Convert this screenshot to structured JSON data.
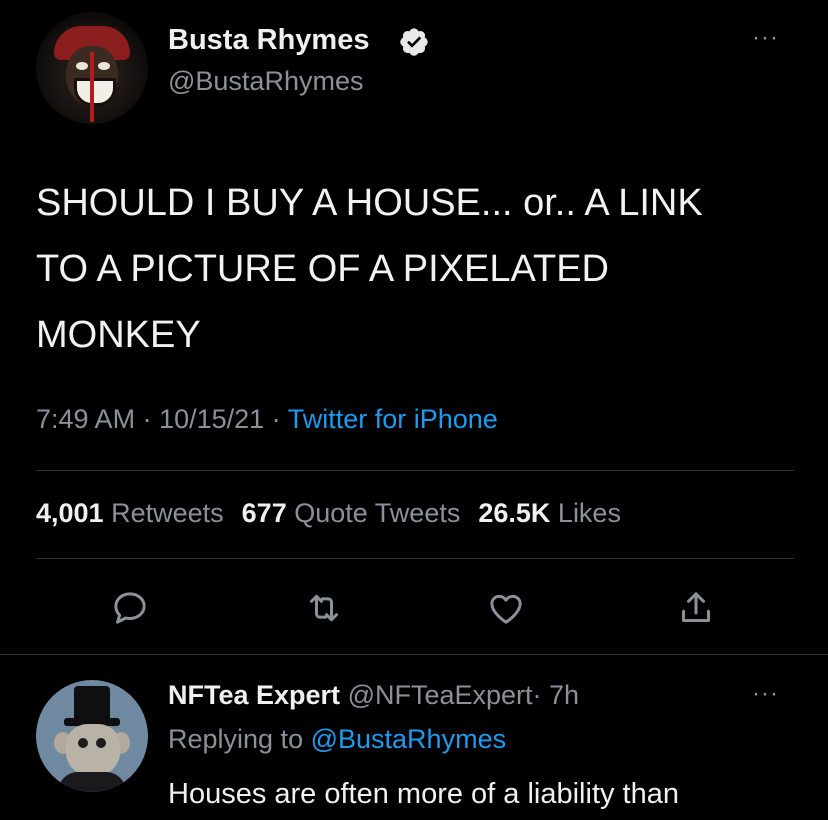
{
  "tweet": {
    "author_name": "Busta Rhymes",
    "author_handle": "@BustaRhymes",
    "verified_icon": "verified-badge-icon",
    "more_icon": "more-options-icon",
    "more_label": "···",
    "text": "SHOULD I BUY A HOUSE... or.. A LINK TO A PICTURE OF A PIXELATED MONKEY",
    "time": "7:49 AM",
    "date": "10/15/21",
    "separator": " · ",
    "source": "Twitter for iPhone",
    "stats": {
      "retweets_count": "4,001",
      "retweets_label": "Retweets",
      "quotes_count": "677",
      "quotes_label": "Quote Tweets",
      "likes_count": "26.5K",
      "likes_label": "Likes"
    },
    "actions": [
      "reply-icon",
      "retweet-icon",
      "like-icon",
      "share-icon"
    ]
  },
  "reply": {
    "author_name": "NFTea Expert",
    "author_handle": "@NFTeaExpert",
    "age": "· 7h",
    "more_label": "···",
    "replying_prefix": "Replying to",
    "replying_to": "@BustaRhymes",
    "text": "Houses are often more of a liability than"
  },
  "colors": {
    "background": "#000000",
    "text": "#f0f0f0",
    "muted": "#8b9199",
    "accent": "#1d9bf0",
    "divider": "#2f3336"
  }
}
